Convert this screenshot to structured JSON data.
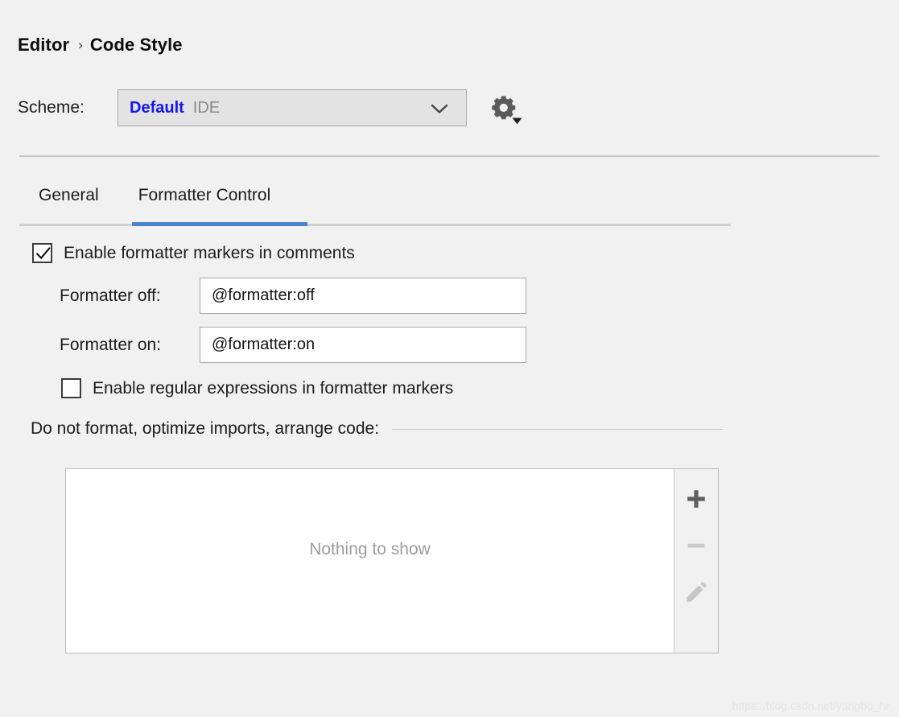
{
  "breadcrumb": {
    "root": "Editor",
    "separator": "›",
    "current": "Code Style"
  },
  "scheme": {
    "label": "Scheme:",
    "value_name": "Default",
    "value_scope": "IDE",
    "dropdown_icon": "chevron-down-icon",
    "gear_icon": "gear-icon"
  },
  "tabs": {
    "items": [
      {
        "label": "General",
        "active": false
      },
      {
        "label": "Formatter Control",
        "active": true
      }
    ],
    "active_color": "#4a86c8"
  },
  "formatter_control": {
    "enable_markers": {
      "label": "Enable formatter markers in comments",
      "checked": true
    },
    "formatter_off": {
      "label": "Formatter off:",
      "value": "@formatter:off",
      "placeholder": ""
    },
    "formatter_on": {
      "label": "Formatter on:",
      "value": "@formatter:on",
      "placeholder": ""
    },
    "enable_regex": {
      "label": "Enable regular expressions in formatter markers",
      "checked": false
    },
    "exclusions": {
      "section_title": "Do not format, optimize imports, arrange code:",
      "empty_text": "Nothing to show",
      "toolbar": [
        {
          "name": "add-button",
          "icon": "plus-icon",
          "enabled": true
        },
        {
          "name": "remove-button",
          "icon": "minus-icon",
          "enabled": false
        },
        {
          "name": "edit-button",
          "icon": "pencil-icon",
          "enabled": false
        }
      ]
    }
  },
  "watermark": {
    "text": "https://blog.csdn.net/yangbo_hr"
  }
}
